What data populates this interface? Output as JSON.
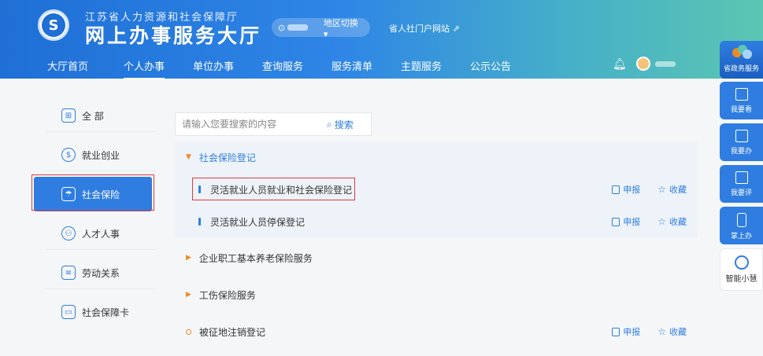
{
  "header": {
    "org_name": "江苏省人力资源和社会保障厅",
    "site_title": "网上办事服务大厅",
    "region_switch": "地区切换",
    "portal_link": "省人社门户网站"
  },
  "nav": {
    "items": [
      {
        "label": "大厅首页"
      },
      {
        "label": "个人办事"
      },
      {
        "label": "单位办事"
      },
      {
        "label": "查询服务"
      },
      {
        "label": "服务清单"
      },
      {
        "label": "主题服务"
      },
      {
        "label": "公示公告"
      }
    ],
    "active_index": 1
  },
  "left_menu": {
    "items": [
      {
        "label": "全 部",
        "icon": "grid-icon"
      },
      {
        "label": "就业创业",
        "icon": "employment-icon"
      },
      {
        "label": "社会保险",
        "icon": "umbrella-icon"
      },
      {
        "label": "人才人事",
        "icon": "people-icon"
      },
      {
        "label": "劳动关系",
        "icon": "document-icon"
      },
      {
        "label": "社会保障卡",
        "icon": "card-icon"
      }
    ],
    "active_index": 2
  },
  "search": {
    "placeholder": "请输入您要搜索的内容",
    "button_label": "搜索"
  },
  "sections": [
    {
      "title": "社会保险登记",
      "expanded": true,
      "rows": [
        {
          "title": "灵活就业人员就业和社会保险登记",
          "apply_label": "申报",
          "favorite_label": "收藏"
        },
        {
          "title": "灵活就业人员停保登记",
          "apply_label": "申报",
          "favorite_label": "收藏"
        }
      ]
    },
    {
      "title": "企业职工基本养老保险服务",
      "expanded": false
    },
    {
      "title": "工伤保险服务",
      "expanded": false
    },
    {
      "title": "被征地注销登记",
      "expanded": false,
      "apply_label": "申报",
      "favorite_label": "收藏"
    }
  ],
  "float_bar": {
    "items": [
      {
        "label": "省政务服务"
      },
      {
        "label": "我要看"
      },
      {
        "label": "我要办"
      },
      {
        "label": "我要评"
      },
      {
        "label": "掌上办"
      },
      {
        "label": "智能小慧"
      }
    ]
  },
  "colors": {
    "primary": "#2f7de1",
    "accent_orange": "#ef8a1f",
    "highlight_red": "#e0383b"
  }
}
